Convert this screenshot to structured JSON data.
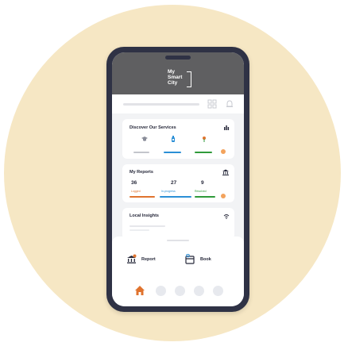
{
  "app": {
    "logo_lines": [
      "My",
      "Smart",
      "City"
    ]
  },
  "colors": {
    "accent_orange": "#f3a35c",
    "home_orange": "#e0732e",
    "green": "#2f9a3a",
    "blue": "#2b8fd6",
    "header_gray": "#5f5f61"
  },
  "icons": {
    "grid": "grid-icon",
    "bell": "bell-icon",
    "home": "home-icon",
    "report": "report-icon",
    "book": "book-icon"
  },
  "services": {
    "title": "Discover Our Services",
    "icons": [
      "graduation-cap-icon",
      "bottle-icon",
      "tree-icon"
    ]
  },
  "reports": {
    "title": "My Reports",
    "stats": [
      {
        "value": "36",
        "label": "Logged"
      },
      {
        "value": "27",
        "label": "In-progress"
      },
      {
        "value": "9",
        "label": "Resolved"
      }
    ]
  },
  "insights": {
    "title": "Local Insights"
  },
  "actions": {
    "report_label": "Report",
    "book_label": "Book"
  }
}
